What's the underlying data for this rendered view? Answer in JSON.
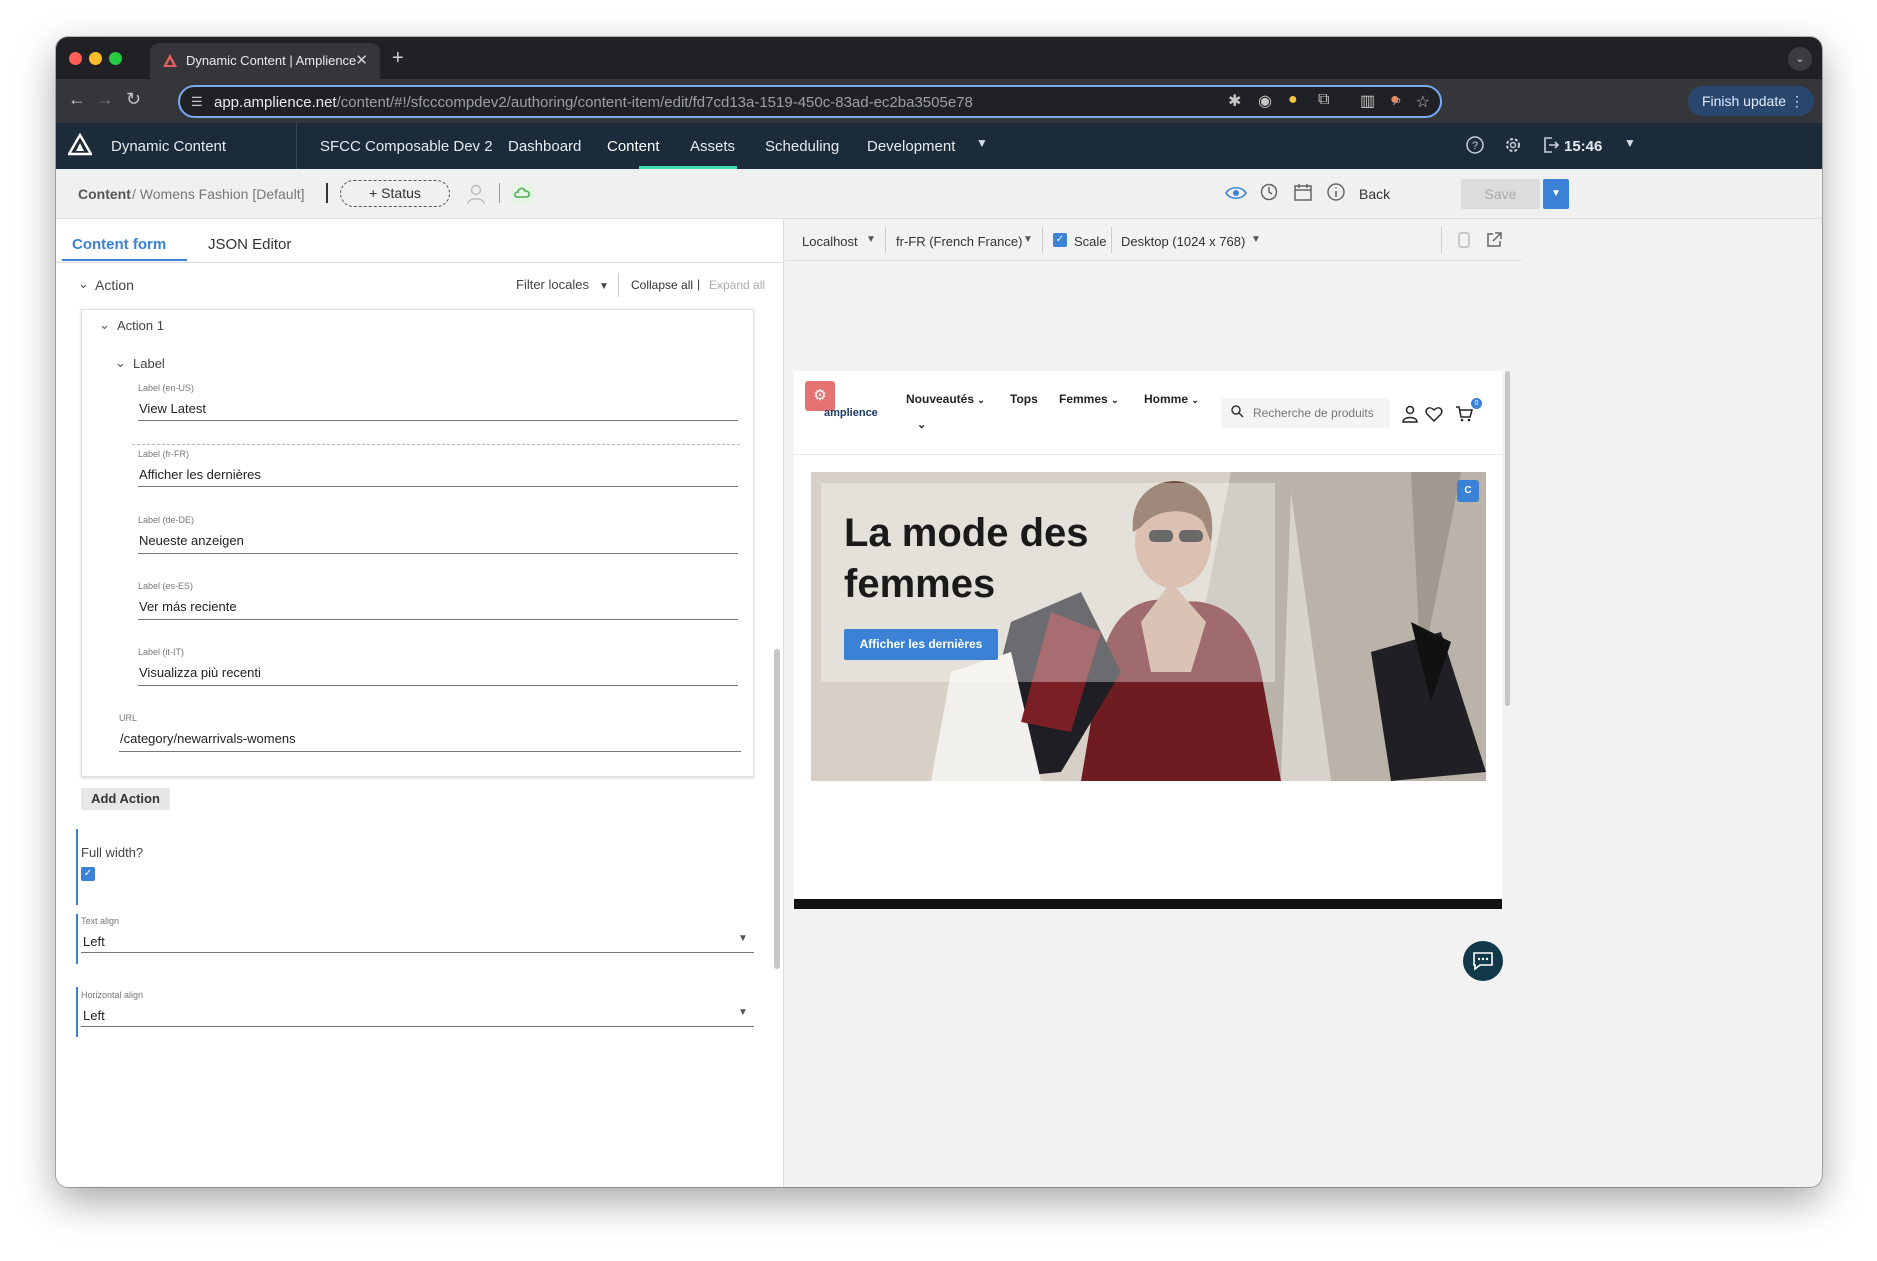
{
  "browser": {
    "tab_title": "Dynamic Content | Amplience",
    "url_host": "app.amplience.net",
    "url_path": "/content/#!/sfcccompdev2/authoring/content-item/edit/fd7cd13a-1519-450c-83ad-ec2ba3505e78",
    "finish_update_label": "Finish update"
  },
  "app": {
    "name": "Dynamic Content",
    "hub": "SFCC Composable Dev 2",
    "nav": [
      "Dashboard",
      "Content",
      "Assets",
      "Scheduling",
      "Development"
    ],
    "active_nav": "Content",
    "time": "15:46",
    "accent_color": "#3ddcb0"
  },
  "subheader": {
    "crumb_root": "Content",
    "crumb_rest": "/ Womens Fashion [Default]",
    "status_label": "+ Status",
    "back_label": "Back",
    "save_label": "Save"
  },
  "form": {
    "tabs": [
      "Content form",
      "JSON Editor"
    ],
    "action_heading": "Action",
    "filter_locales": "Filter locales",
    "collapse_all": "Collapse all",
    "expand_all": "Expand all",
    "action1_heading": "Action 1",
    "label_heading": "Label",
    "labels": [
      {
        "locale": "Label (en-US)",
        "value": "View Latest"
      },
      {
        "locale": "Label (fr-FR)",
        "value": "Afficher les dernières"
      },
      {
        "locale": "Label (de-DE)",
        "value": "Neueste anzeigen"
      },
      {
        "locale": "Label (es-ES)",
        "value": "Ver más reciente"
      },
      {
        "locale": "Label (it-IT)",
        "value": "Visualizza più recenti"
      }
    ],
    "url_label": "URL",
    "url_value": "/category/newarrivals-womens",
    "add_action": "Add Action",
    "full_width_label": "Full width?",
    "full_width_checked": true,
    "text_align_label": "Text align",
    "text_align_value": "Left",
    "horizontal_align_label": "Horizontal align",
    "horizontal_align_value": "Left"
  },
  "preview_bar": {
    "environment": "Localhost",
    "locale": "fr-FR (French France)",
    "scale_label": "Scale",
    "scale_checked": true,
    "device": "Desktop (1024 x 768)"
  },
  "preview": {
    "logo_text": "amplience",
    "nav": [
      "Nouveautés",
      "Tops",
      "Femmes",
      "Homme"
    ],
    "search_placeholder": "Recherche de produits",
    "cart_count": "0",
    "hero_title": "La mode des femmes",
    "hero_button": "Afficher les dernières",
    "hero_badge": "C"
  }
}
